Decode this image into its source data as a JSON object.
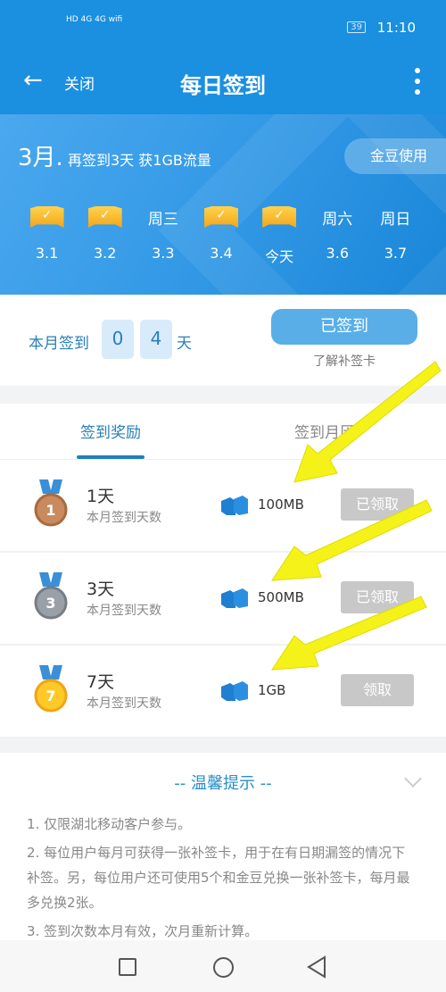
{
  "status_bar": {
    "signal": "HD 4G 4G wifi",
    "battery": "39",
    "time": "11:10"
  },
  "header": {
    "back_icon": "arrow-left-icon",
    "close_label": "关闭",
    "title": "每日签到",
    "more_icon": "more-vertical-icon"
  },
  "banner": {
    "month": "3月.",
    "message": "再签到3天 获1GB流量",
    "gold_button": "金豆使用",
    "days": [
      {
        "top": "",
        "signed": true,
        "date": "3.1"
      },
      {
        "top": "",
        "signed": true,
        "date": "3.2"
      },
      {
        "top": "周三",
        "signed": false,
        "date": "3.3"
      },
      {
        "top": "",
        "signed": true,
        "date": "3.4"
      },
      {
        "top": "",
        "signed": true,
        "date": "今天"
      },
      {
        "top": "周六",
        "signed": false,
        "date": "3.6"
      },
      {
        "top": "周日",
        "signed": false,
        "date": "3.7"
      }
    ]
  },
  "checkin": {
    "label": "本月签到",
    "digit1": "0",
    "digit2": "4",
    "unit": "天",
    "signed_button": "已签到",
    "learn_link": "了解补签卡"
  },
  "tabs": [
    {
      "label": "签到奖励",
      "active": true
    },
    {
      "label": "签到月历",
      "active": false
    }
  ],
  "rewards": [
    {
      "days": "1天",
      "sub": "本月签到天数",
      "amount": "100MB",
      "button": "已领取",
      "medal": "bronze",
      "medal_num": "1"
    },
    {
      "days": "3天",
      "sub": "本月签到天数",
      "amount": "500MB",
      "button": "已领取",
      "medal": "silver",
      "medal_num": "3"
    },
    {
      "days": "7天",
      "sub": "本月签到天数",
      "amount": "1GB",
      "button": "领取",
      "medal": "gold",
      "medal_num": "7"
    }
  ],
  "tips": {
    "title": "-- 温馨提示 --",
    "items": [
      "1. 仅限湖北移动客户参与。",
      "2. 每位用户每月可获得一张补签卡，用于在有日期漏签的情况下补签。另，每位用户还可使用5个和金豆兑换一张补签卡，每月最多兑换2张。",
      "3. 签到次数本月有效，次月重新计算。"
    ]
  },
  "colors": {
    "primary": "#1b8fe0",
    "accent_text": "#2a7fb8",
    "annotation_arrow": "#f5f21a"
  }
}
